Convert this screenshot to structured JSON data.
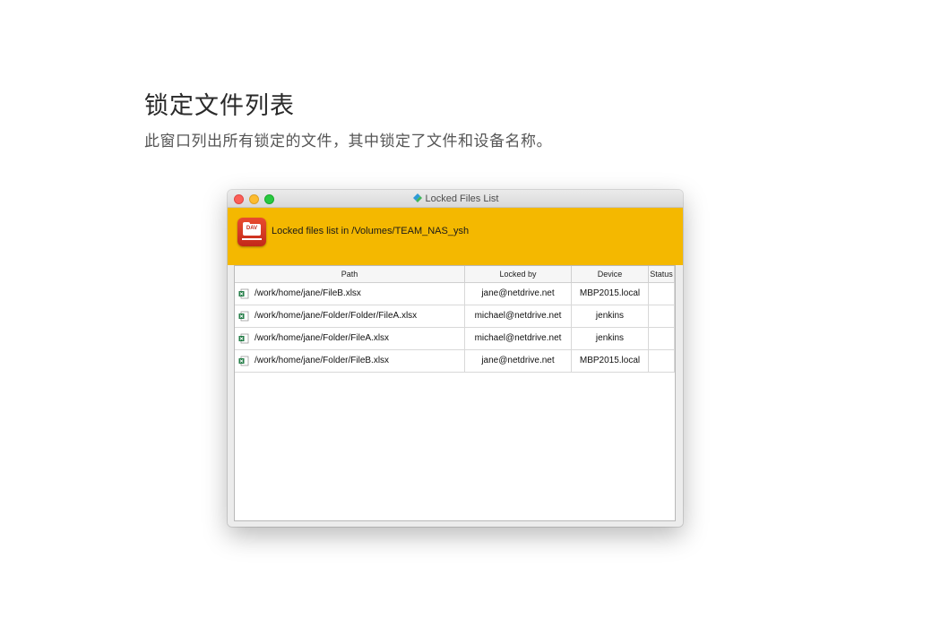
{
  "page": {
    "heading": "锁定文件列表",
    "subtitle": "此窗口列出所有锁定的文件，其中锁定了文件和设备名称。"
  },
  "window": {
    "title": "Locked Files List",
    "banner_text": "Locked files list in /Volumes/TEAM_NAS_ysh",
    "app_icon_label": "DAV"
  },
  "table": {
    "columns": [
      "Path",
      "Locked by",
      "Device",
      "Status"
    ],
    "rows": [
      {
        "path": "/work/home/jane/FileB.xlsx",
        "locked_by": "jane@netdrive.net",
        "device": "MBP2015.local",
        "status": ""
      },
      {
        "path": "/work/home/jane/Folder/Folder/FileA.xlsx",
        "locked_by": "michael@netdrive.net",
        "device": "jenkins",
        "status": ""
      },
      {
        "path": "/work/home/jane/Folder/FileA.xlsx",
        "locked_by": "michael@netdrive.net",
        "device": "jenkins",
        "status": ""
      },
      {
        "path": "/work/home/jane/Folder/FileB.xlsx",
        "locked_by": "jane@netdrive.net",
        "device": "MBP2015.local",
        "status": ""
      }
    ]
  },
  "colors": {
    "banner": "#f4b800",
    "excel_green": "#1f7a43",
    "app_icon_red": "#d9361f"
  },
  "icons": {
    "file_icon": "excel-file-icon",
    "title_icon": "netdrive-icon"
  }
}
